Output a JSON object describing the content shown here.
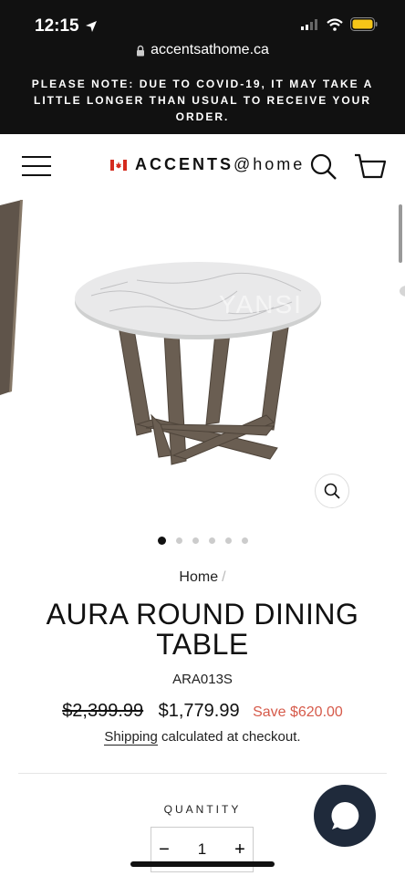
{
  "status_bar": {
    "time": "12:15",
    "url": "accentsathome.ca"
  },
  "announcement": "PLEASE NOTE: DUE TO COVID-19, IT MAY TAKE A LITTLE LONGER THAN USUAL TO RECEIVE YOUR ORDER.",
  "header": {
    "logo_bold": "ACCENTS",
    "logo_rest": "@home"
  },
  "gallery": {
    "image_count": 6,
    "active_index": 1,
    "watermark": "YANSI"
  },
  "product": {
    "breadcrumb": "Home",
    "breadcrumb_sep": "/",
    "title": "AURA ROUND DINING TABLE",
    "sku": "ARA013S",
    "price_original": "$2,399.99",
    "price_sale": "$1,779.99",
    "savings": "Save $620.00",
    "shipping_link": "Shipping",
    "shipping_text": " calculated at checkout."
  },
  "quantity": {
    "label": "QUANTITY",
    "value": "1",
    "minus": "−",
    "plus": "+"
  },
  "colors": {
    "dark": "#111111",
    "accent_save": "#d65a4a",
    "chat": "#1f2a3b"
  }
}
